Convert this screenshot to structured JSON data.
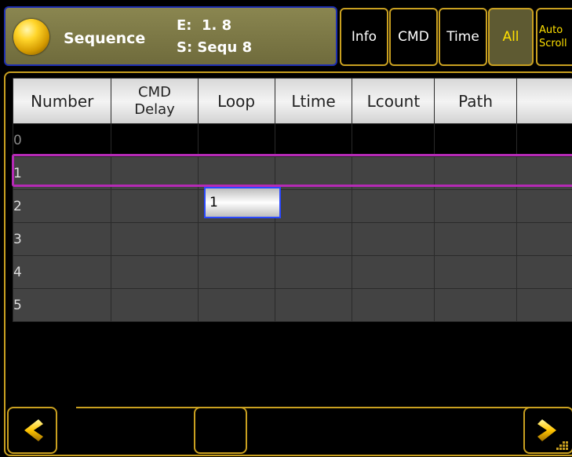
{
  "header": {
    "title": "Sequence",
    "executor_line": "E:  1. 8",
    "sequence_line": "S: Sequ 8"
  },
  "toolbar": {
    "info_label": "Info",
    "cmd_label": "CMD",
    "time_label": "Time",
    "all_label": "All",
    "auto_scroll_line1": "Auto",
    "auto_scroll_line2": "Scroll"
  },
  "table": {
    "columns": [
      "Number",
      "CMD Delay",
      "Loop",
      "Ltime",
      "Lcount",
      "Path",
      ""
    ],
    "rows": [
      {
        "number": "0"
      },
      {
        "number": "1"
      },
      {
        "number": "2",
        "loop": "1"
      },
      {
        "number": "3"
      },
      {
        "number": "4"
      },
      {
        "number": "5"
      }
    ],
    "editing_value": "1"
  },
  "colors": {
    "accent": "#c9a020",
    "selection": "#b52ab5",
    "edit_border": "#2a48ff"
  },
  "icons": {
    "scroll_left": "chevron-left-icon",
    "scroll_right": "chevron-right-icon"
  }
}
